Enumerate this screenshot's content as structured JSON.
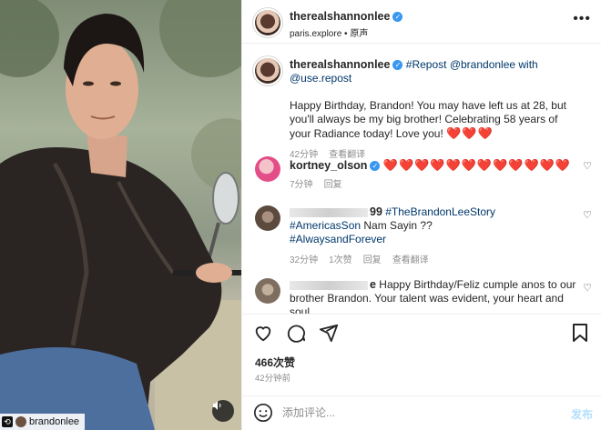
{
  "post": {
    "author": "therealshannonlee",
    "location": "paris.explore",
    "audio": "原声",
    "repost_tag": "brandonlee"
  },
  "caption": {
    "author": "therealshannonlee",
    "repost": "#Repost @brandonlee with @use.repost",
    "text": "Happy Birthday, Brandon! You may have left us at 28, but you'll always be my big brother! Celebrating 58 years of your Radiance today! Love you!",
    "hearts": "❤️❤️❤️",
    "time": "42分钟",
    "translate": "查看翻译"
  },
  "comments": [
    {
      "author": "kortney_olson",
      "text": "❤️❤️❤️❤️❤️❤️❤️❤️❤️❤️❤️❤️",
      "time": "7分钟",
      "reply": "回复"
    },
    {
      "author_suffix": "99",
      "text_1": "#TheBrandonLeeStory",
      "text_2": "#AmericasSon",
      "text_3": "Nam Sayin ??",
      "text_4": "#AlwaysandForever",
      "time": "32分钟",
      "likes": "1次赞",
      "reply": "回复",
      "translate": "查看翻译"
    },
    {
      "author_suffix": "e",
      "text": "Happy Birthday/Feliz cumple anos to our brother Brandon. Your talent was evident, your heart and soul"
    }
  ],
  "stats": {
    "likes": "466次赞",
    "ago": "42分钟前"
  },
  "composer": {
    "placeholder": "添加评论...",
    "post_label": "发布"
  },
  "colors": {
    "verified": "#3897f0",
    "link": "#00376b",
    "heart": "#ed1c24",
    "post_disabled": "#b2dffc"
  }
}
